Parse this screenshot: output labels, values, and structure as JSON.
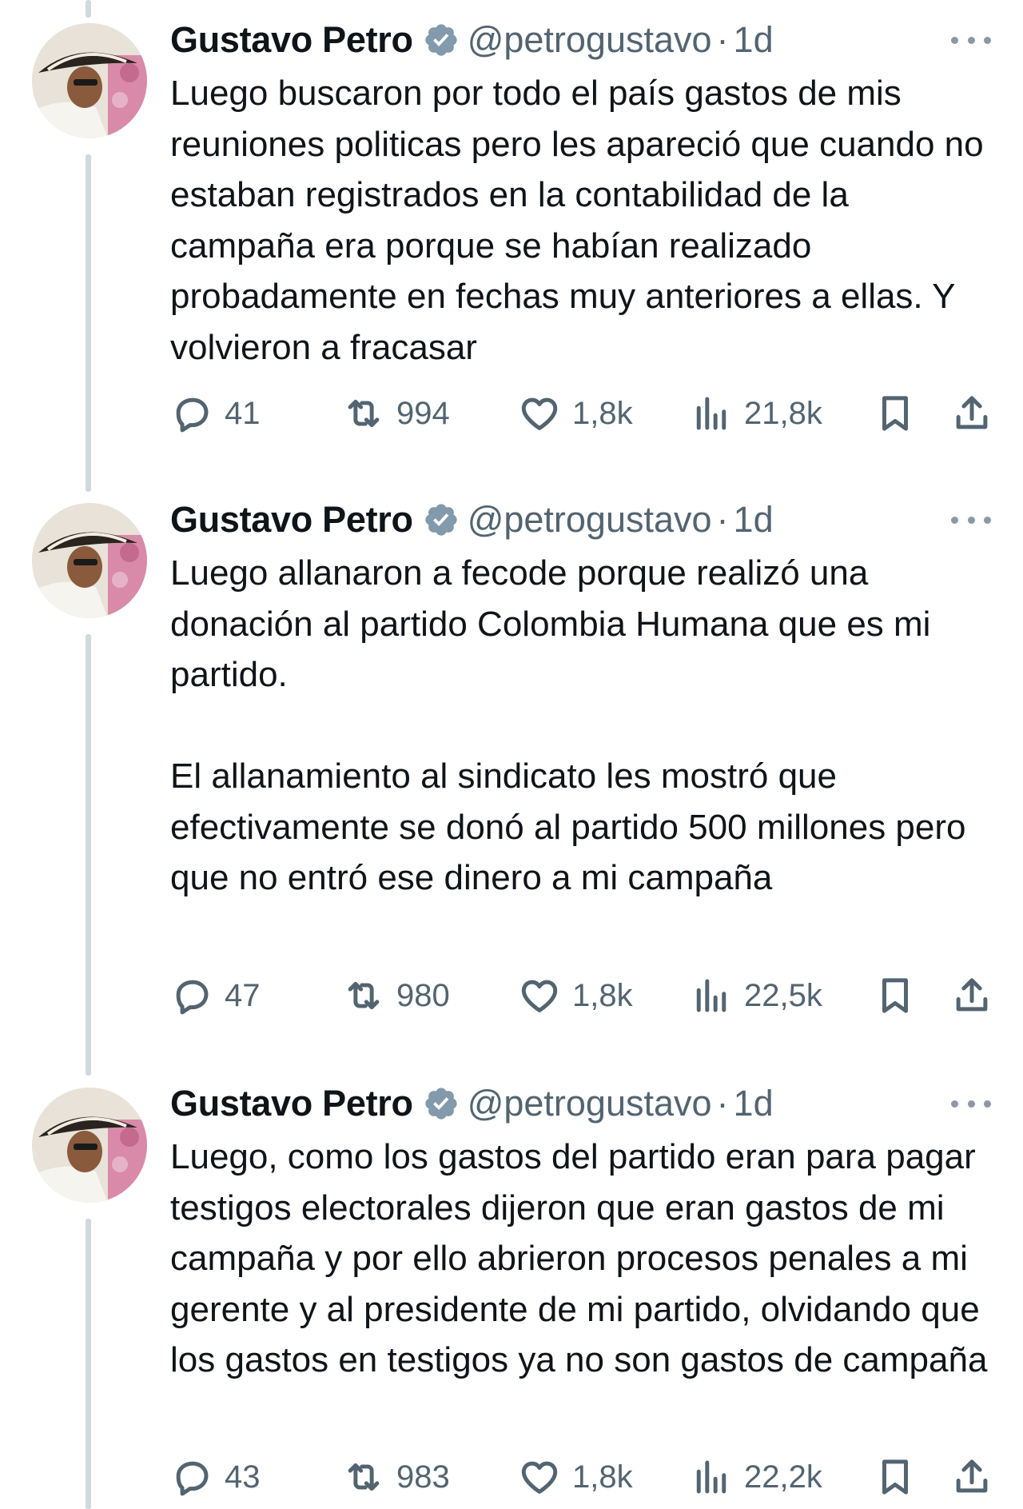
{
  "tweets": [
    {
      "author_name": "Gustavo Petro",
      "author_handle": "@petrogustavo",
      "separator": "·",
      "time": "1d",
      "text": "Luego buscaron por todo el país gastos de mis reuniones politicas pero les apareció que cuando no estaban registrados en la contabilidad de la campaña era porque se habían realizado probadamente en fechas muy anteriores a ellas. Y volvieron a fracasar",
      "replies": "41",
      "retweets": "994",
      "likes": "1,8k",
      "views": "21,8k"
    },
    {
      "author_name": "Gustavo Petro",
      "author_handle": "@petrogustavo",
      "separator": "·",
      "time": "1d",
      "text": "Luego allanaron a fecode porque realizó una donación al partido Colombia Humana que es mi partido.\n\nEl allanamiento al sindicato les mostró que efectivamente se donó al partido 500 millones pero que no entró ese dinero a mi campaña",
      "replies": "47",
      "retweets": "980",
      "likes": "1,8k",
      "views": "22,5k"
    },
    {
      "author_name": "Gustavo Petro",
      "author_handle": "@petrogustavo",
      "separator": "·",
      "time": "1d",
      "text": "Luego, como los gastos del partido eran para pagar testigos electorales dijeron que eran gastos de mi campaña y por ello abrieron procesos penales a mi gerente y al presidente de mi partido, olvidando que los gastos en testigos ya no son gastos de campaña",
      "replies": "43",
      "retweets": "983",
      "likes": "1,8k",
      "views": "22,2k"
    }
  ],
  "icons": {
    "verified": "verified-badge-icon",
    "more": "more-options-icon",
    "reply": "reply-icon",
    "retweet": "retweet-icon",
    "like": "heart-icon",
    "views": "views-icon",
    "bookmark": "bookmark-icon",
    "share": "share-icon"
  },
  "colors": {
    "text": "#0f1419",
    "secondary": "#536471",
    "thread_line": "#cfd9de",
    "verified_badge": "#829aab"
  }
}
